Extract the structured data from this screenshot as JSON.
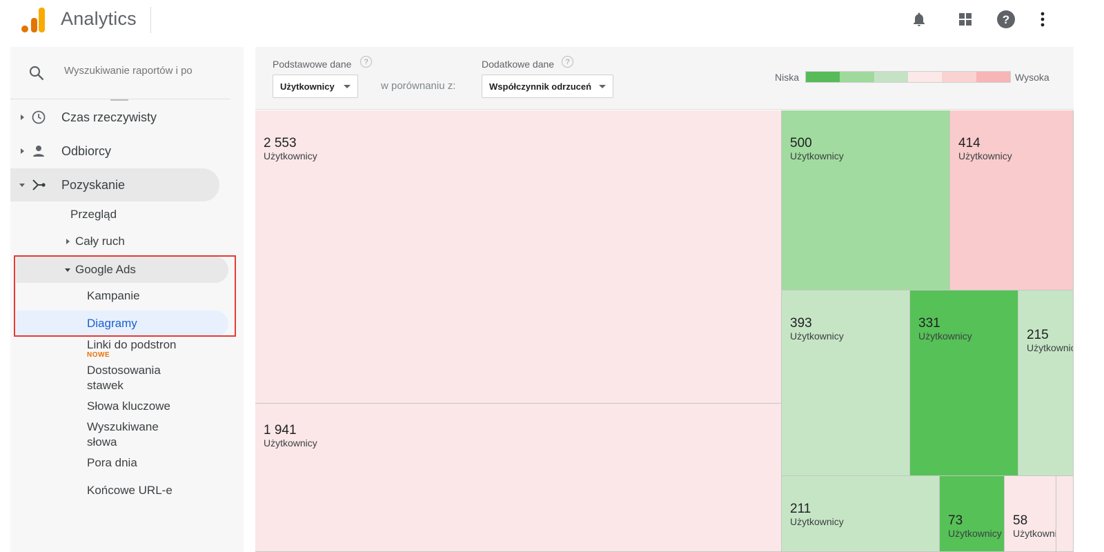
{
  "app": {
    "title": "Analytics"
  },
  "topbar": {
    "icons": [
      "bell-icon",
      "apps-grid-icon",
      "help-icon",
      "more-vert-icon"
    ]
  },
  "sidebar": {
    "search_placeholder": "Wyszukiwanie raportów i po",
    "items": [
      {
        "label": "Czas rzeczywisty",
        "icon": "clock-icon"
      },
      {
        "label": "Odbiorcy",
        "icon": "person-icon"
      },
      {
        "label": "Pozyskanie",
        "icon": "acquisition-icon"
      }
    ],
    "acquisition_children": {
      "overview": "Przegląd",
      "all_traffic": "Cały ruch",
      "google_ads": "Google Ads",
      "google_ads_children": {
        "campaigns": "Kampanie",
        "treemaps": "Diagramy",
        "sitelinks": "Linki do podstron",
        "sitelinks_badge": "NOWE",
        "bid_adjustments_1": "Dostosowania",
        "bid_adjustments_2": "stawek",
        "keywords": "Słowa kluczowe",
        "search_queries_1": "Wyszukiwane",
        "search_queries_2": "słowa",
        "hour_of_day": "Pora dnia",
        "final_urls": "Końcowe URL-e"
      }
    }
  },
  "controls": {
    "primary_label": "Podstawowe dane",
    "primary_value": "Użytkownicy",
    "compare_label": "w porównaniu z:",
    "secondary_label": "Dodatkowe dane",
    "secondary_value": "Współczynnik odrzuceń",
    "help_glyph": "?",
    "legend_low": "Niska",
    "legend_high": "Wysoka",
    "legend_colors": [
      "#57bb5a",
      "#9fd99c",
      "#c5e3c4",
      "#fce8e8",
      "#fad2d2",
      "#f8b5b5"
    ]
  },
  "treemap": {
    "metric_label": "Użytkownicy",
    "tiles": [
      {
        "value": "2 553",
        "label": "Użytkownicy",
        "color": "#fbe7e8"
      },
      {
        "value": "1 941",
        "label": "Użytkownicy",
        "color": "#fbe7e8"
      },
      {
        "value": "500",
        "label": "Użytkownicy",
        "color": "#a2db9f"
      },
      {
        "value": "414",
        "label": "Użytkownicy",
        "color": "#f9cbcc"
      },
      {
        "value": "393",
        "label": "Użytkownicy",
        "color": "#c6e5c5"
      },
      {
        "value": "331",
        "label": "Użytkownicy",
        "color": "#56c157"
      },
      {
        "value": "215",
        "label": "Użytkownicy",
        "color": "#c6e5c5"
      },
      {
        "value": "211",
        "label": "Użytkownicy",
        "color": "#c6e5c5"
      },
      {
        "value": "73",
        "label": "Użytkownicy",
        "color": "#56c157"
      },
      {
        "value": "58",
        "label": "Użytkownicy",
        "color": "#fbe7e8"
      },
      {
        "value": "",
        "label": "",
        "color": "#fbe7e8"
      }
    ]
  }
}
